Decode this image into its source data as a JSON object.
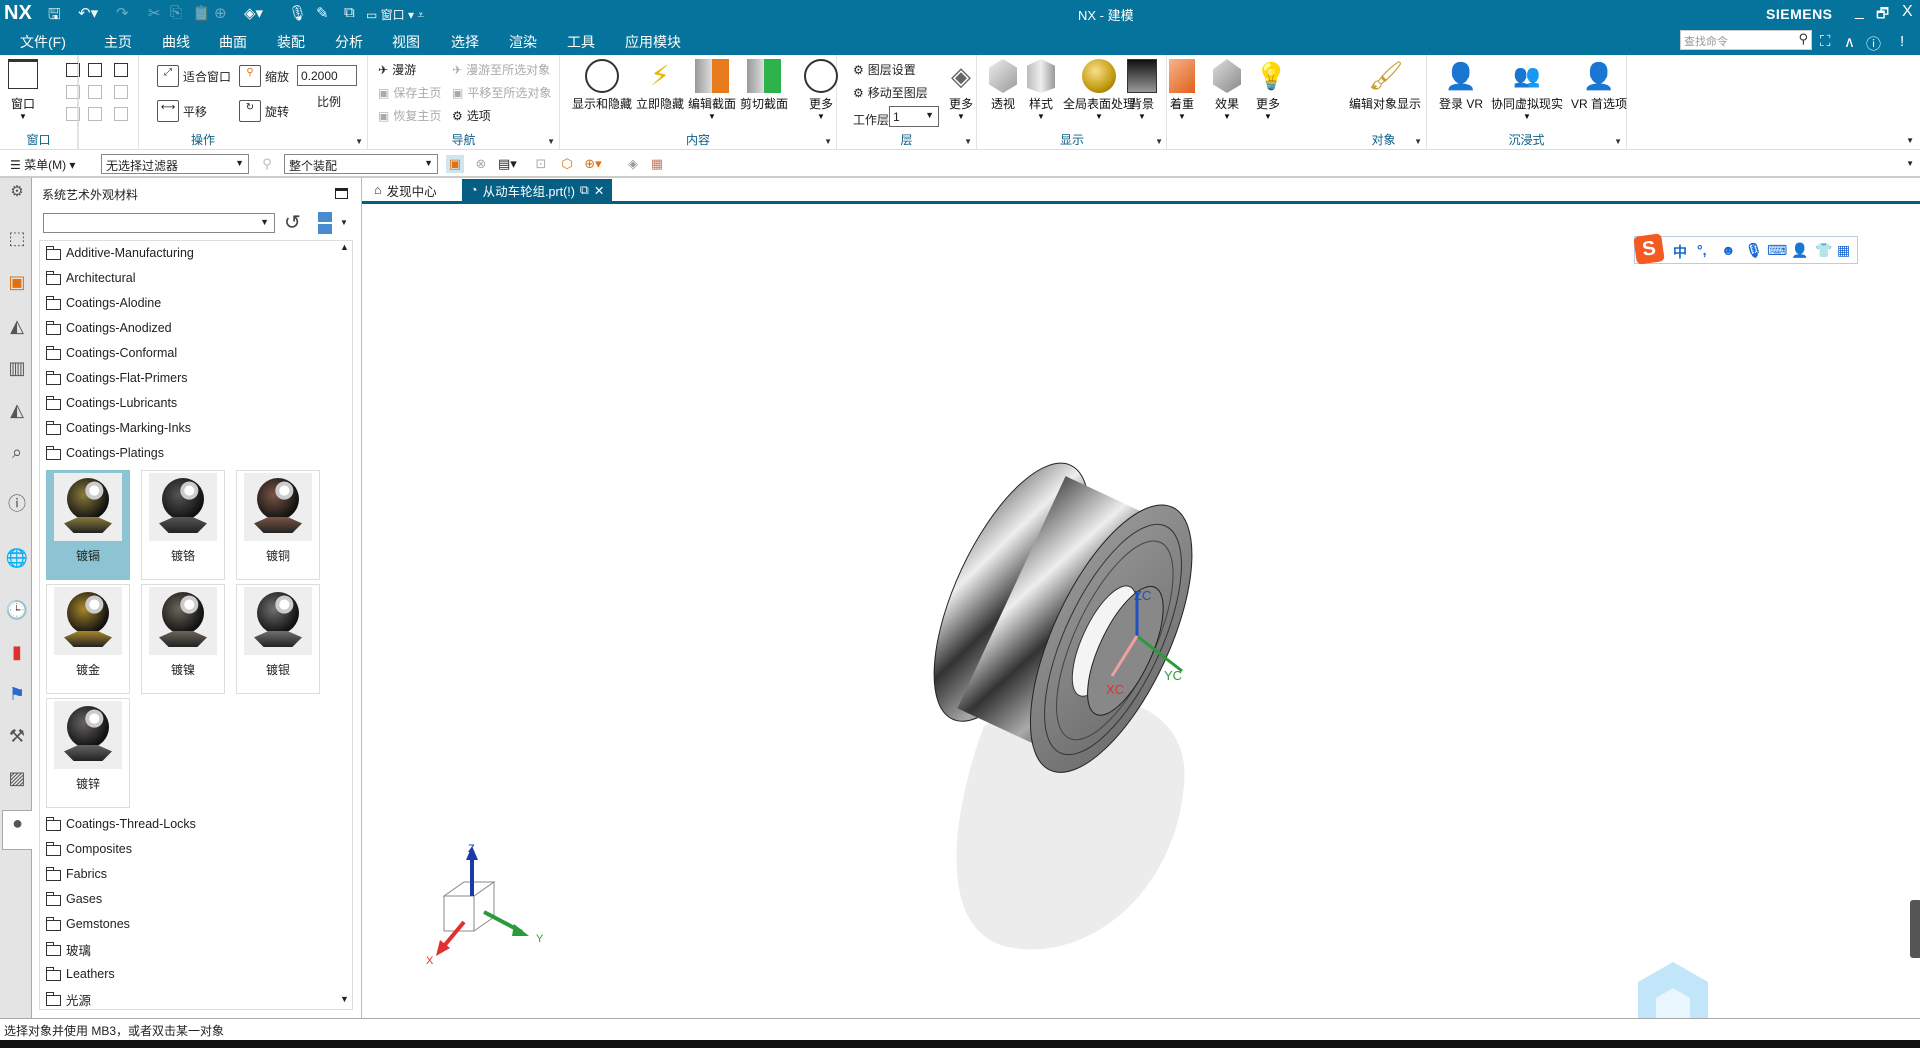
{
  "titlebar": {
    "app_logo": "NX",
    "window_title": "NX - 建模",
    "brand": "SIEMENS",
    "quick_window_label": "窗口",
    "controls": {
      "minimize": "_",
      "restore": "🗗",
      "close": "X"
    }
  },
  "menubar": {
    "tabs": [
      {
        "label": "文件(F)"
      },
      {
        "label": "主页"
      },
      {
        "label": "曲线"
      },
      {
        "label": "曲面"
      },
      {
        "label": "装配"
      },
      {
        "label": "分析"
      },
      {
        "label": "视图",
        "active": true
      },
      {
        "label": "选择"
      },
      {
        "label": "渲染"
      },
      {
        "label": "工具"
      },
      {
        "label": "应用模块"
      }
    ],
    "search_placeholder": "查找命令"
  },
  "ribbon": {
    "window_group": {
      "label": "窗口",
      "button": "窗口"
    },
    "operation_group": {
      "label": "操作",
      "fit": "适合窗口",
      "zoom": "缩放",
      "scale_value": "0.2000",
      "scale_label": "比例",
      "pan": "平移",
      "rotate": "旋转"
    },
    "navigation_group": {
      "label": "导航",
      "fly": "漫游",
      "fly_to_selected": "漫游至所选对象",
      "save_home": "保存主页",
      "pan_to_selected": "平移至所选对象",
      "restore_home": "恢复主页",
      "options": "选项"
    },
    "content_group": {
      "label": "内容",
      "show_hide": "显示和隐藏",
      "immediate_hide": "立即隐藏",
      "edit_section": "编辑截面",
      "clip_section": "剪切截面",
      "more": "更多"
    },
    "layer_group": {
      "label": "层",
      "layer_settings": "图层设置",
      "move_to_layer": "移动至图层",
      "work_layer_label": "工作层",
      "work_layer_value": "1",
      "more": "更多"
    },
    "display_group": {
      "label": "显示",
      "perspective": "透视",
      "style": "样式",
      "global_finish": "全局表面处理",
      "background": "背景",
      "shading": "着重",
      "effects": "效果",
      "more": "更多"
    },
    "object_group": {
      "label": "对象",
      "edit_object_display": "编辑对象显示"
    },
    "immersive_group": {
      "label": "沉浸式",
      "login_vr": "登录 VR",
      "collab_vr": "协同虚拟现实",
      "vr_prefs": "VR 首选项"
    }
  },
  "toolbar": {
    "menu_label": "菜单(M)",
    "filter_value": "无选择过滤器",
    "scope_value": "整个装配"
  },
  "panel": {
    "title": "系统艺术外观材料",
    "combo_value": "",
    "folders_top": [
      "Additive-Manufacturing",
      "Architectural",
      "Coatings-Alodine",
      "Coatings-Anodized",
      "Coatings-Conformal",
      "Coatings-Flat-Primers",
      "Coatings-Lubricants",
      "Coatings-Marking-Inks",
      "Coatings-Platings"
    ],
    "materials": [
      {
        "label": "镀镉",
        "tint": "#8a7a3a",
        "selected": true
      },
      {
        "label": "镀铬",
        "tint": "#555555"
      },
      {
        "label": "镀铜",
        "tint": "#7a5545"
      },
      {
        "label": "镀金",
        "tint": "#a8862a"
      },
      {
        "label": "镀镍",
        "tint": "#6b665a"
      },
      {
        "label": "镀银",
        "tint": "#707070"
      },
      {
        "label": "镀锌",
        "tint": "#666262"
      }
    ],
    "folders_bottom": [
      "Coatings-Thread-Locks",
      "Composites",
      "Fabrics",
      "Gases",
      "Gemstones",
      "玻璃",
      "Leathers",
      "光源"
    ]
  },
  "doctabs": [
    {
      "label": "发现中心"
    },
    {
      "label": "从动车轮组.prt(!)",
      "active": true
    }
  ],
  "viewport": {
    "csys_labels": {
      "zc": "ZC",
      "yc": "YC",
      "xc": "XC"
    },
    "triad_labels": {
      "z": "Z",
      "y": "Y",
      "x": "X"
    },
    "ime_bar": {
      "logo": "S",
      "mode": "中",
      "punct": "°,"
    }
  },
  "status": {
    "message": "选择对象并使用 MB3，或者双击某一对象"
  },
  "colors": {
    "brand_blue": "#06739c",
    "active_tab": "#055f84",
    "selected_tile": "#8cc4d3",
    "x_axis": "#e03030",
    "y_axis": "#2a9a3a",
    "z_axis": "#2050c0"
  }
}
